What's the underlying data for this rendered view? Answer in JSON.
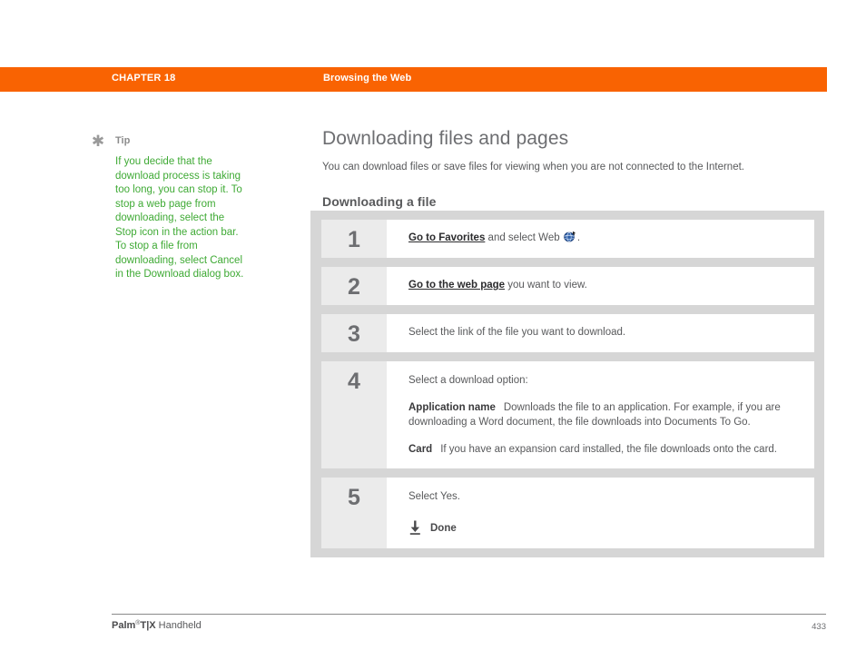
{
  "header": {
    "chapter_label": "CHAPTER 18",
    "chapter_title": "Browsing the Web",
    "bar_color": "#f96302"
  },
  "tip": {
    "icon": "asterisk-icon",
    "label": "Tip",
    "text": "If you decide that the download process is taking too long, you can stop it. To stop a web page from downloading, select the Stop icon in the action bar. To stop a file from downloading, select Cancel in the Download dialog box.",
    "text_color": "#3faa35"
  },
  "main": {
    "title": "Downloading files and pages",
    "intro": "You can download files or save files for viewing when you are not connected to the Internet.",
    "subtitle": "Downloading a file"
  },
  "steps": [
    {
      "number": "1",
      "lead": "Go to Favorites",
      "rest": " and select Web ",
      "icon": "web-globe-icon",
      "tail": "."
    },
    {
      "number": "2",
      "lead": "Go to the web page",
      "rest": " you want to view."
    },
    {
      "number": "3",
      "text": "Select the link of the file you want to download."
    },
    {
      "number": "4",
      "text": "Select a download option:",
      "options": [
        {
          "term": "Application name",
          "description": "Downloads the file to an application. For example, if you are downloading a Word document, the file downloads into Documents To Go."
        },
        {
          "term": "Card",
          "description": "If you have an expansion card installed, the file downloads onto the card."
        }
      ]
    },
    {
      "number": "5",
      "text": "Select Yes.",
      "done": {
        "icon": "done-download-icon",
        "label": "Done"
      }
    }
  ],
  "footer": {
    "brand_strong": "Palm",
    "brand_sup": "®",
    "brand_model": "T|X",
    "brand_rest": " Handheld",
    "page_number": "433"
  }
}
